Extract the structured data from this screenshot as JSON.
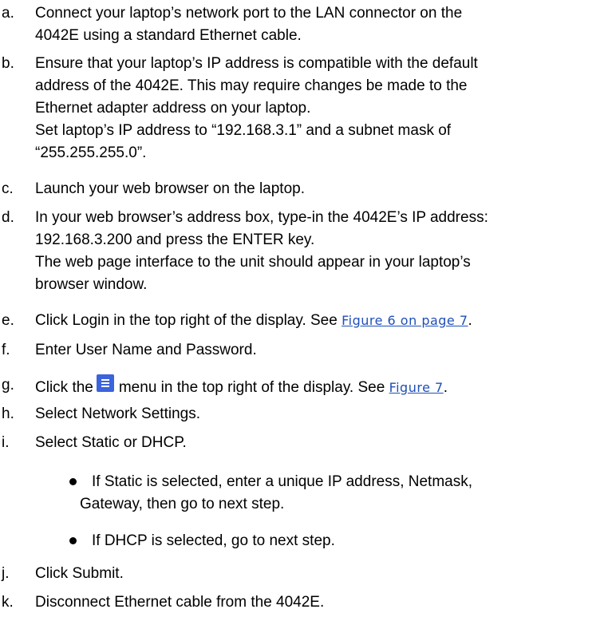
{
  "steps": [
    {
      "marker": "a.",
      "lines": [
        "Connect your laptop’s network port to the LAN connector on the",
        "4042E using a standard Ethernet cable."
      ]
    },
    {
      "marker": "b.",
      "lines": [
        "Ensure that your laptop’s IP address is compatible with the default",
        "address of the 4042E. This may require changes be made to the",
        "Ethernet adapter address on your laptop.",
        "Set laptop’s IP address to “192.168.3.1” and a subnet mask of",
        "“255.255.255.0”."
      ]
    },
    {
      "marker": "c.",
      "lines": [
        "Launch your web browser on the laptop."
      ]
    },
    {
      "marker": "d.",
      "lines": [
        "In your web browser’s address box, type-in the 4042E’s IP address:",
        "192.168.3.200 and press the ENTER key.",
        "The web page interface to the unit should appear in your laptop’s",
        "browser window."
      ]
    },
    {
      "marker": "e.",
      "before": "Click Login in the top right of the display. See ",
      "link": "Figure 6 on page 7",
      "after": "."
    },
    {
      "marker": "f.",
      "lines": [
        "Enter User Name and Password."
      ]
    },
    {
      "marker": "g.",
      "before": "Click the",
      "icon": "hamburger-menu-icon",
      "middle": "menu in the top right of the display. See ",
      "link": "Figure 7",
      "after": "."
    },
    {
      "marker": "h.",
      "lines": [
        "Select Network Settings."
      ]
    },
    {
      "marker": "i.",
      "lines": [
        "Select Static or DHCP."
      ]
    },
    {
      "marker": "j.",
      "lines": [
        "Click Submit."
      ]
    },
    {
      "marker": "k.",
      "lines": [
        "Disconnect Ethernet cable from the 4042E."
      ]
    }
  ],
  "bullets": [
    {
      "lines": [
        "If Static is selected, enter a unique IP address, Netmask,",
        "Gateway, then go to next step."
      ]
    },
    {
      "lines": [
        "If DHCP is selected, go to next step."
      ]
    }
  ],
  "colors": {
    "link": "#1f4fb8",
    "menu_icon": "#3b63dc"
  }
}
